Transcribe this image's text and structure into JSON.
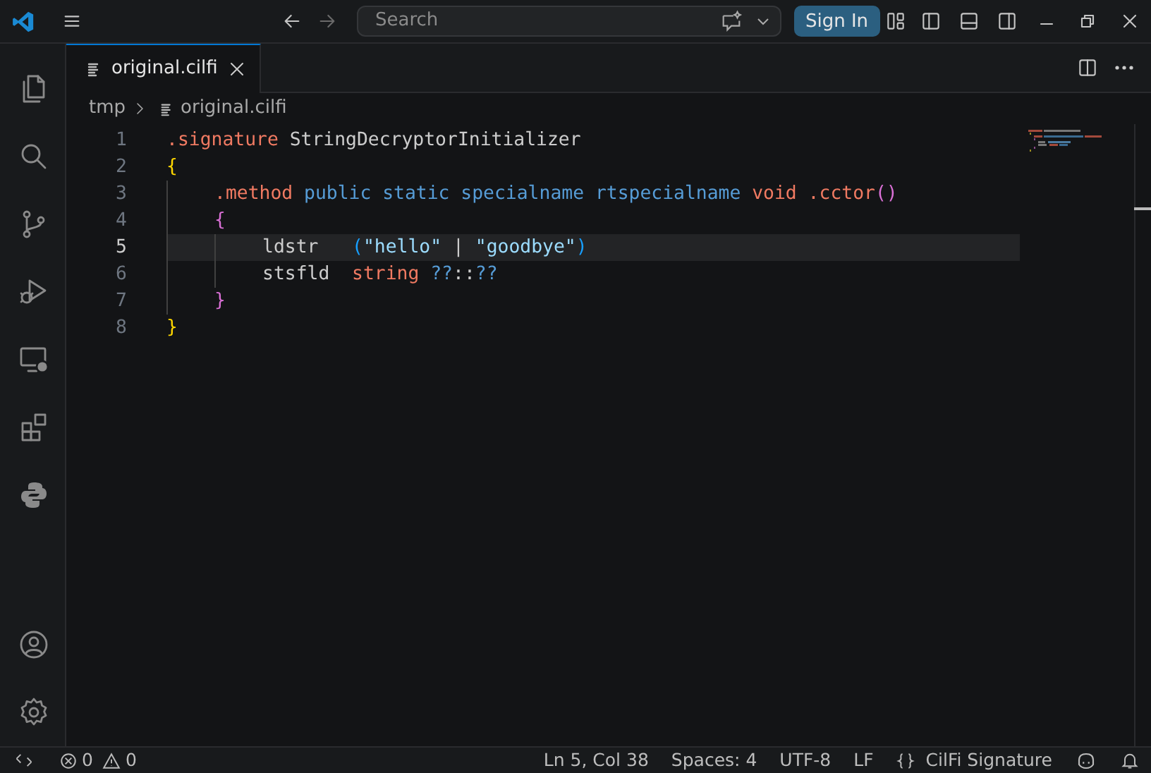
{
  "title_bar": {
    "search": {
      "placeholder": "Search"
    },
    "sign_in": "Sign In"
  },
  "activity_bar": {
    "items": [
      {
        "kind": "files",
        "selected": false
      },
      {
        "kind": "search",
        "selected": false
      },
      {
        "kind": "source-control",
        "selected": false
      },
      {
        "kind": "run-debug",
        "selected": false
      },
      {
        "kind": "remote",
        "selected": false
      },
      {
        "kind": "extensions",
        "selected": false
      },
      {
        "kind": "python",
        "selected": false
      }
    ],
    "bottom": [
      {
        "kind": "account"
      },
      {
        "kind": "settings"
      }
    ]
  },
  "tabs": [
    {
      "label": "original.cilfi",
      "selected": true
    }
  ],
  "breadcrumb": [
    "tmp",
    "original.cilfi"
  ],
  "editor": {
    "lines": [
      {
        "number": "1",
        "current": false,
        "tokens": [
          {
            "text": ".signature",
            "kind": "directive"
          },
          {
            "text": " StringDecryptorInitializer",
            "kind": "plain"
          }
        ]
      },
      {
        "number": "2",
        "current": false,
        "tokens": [
          {
            "text": "{",
            "kind": "brace1"
          }
        ]
      },
      {
        "kind": "block",
        "children": [
          {
            "number": "3",
            "current": false,
            "tokens": [
              {
                "text": ".method",
                "kind": "directive"
              },
              {
                "text": " public static specialname rtspecialname",
                "kind": "keyword"
              },
              {
                "text": " void .cctor",
                "kind": "directive"
              },
              {
                "text": "()",
                "kind": "brace2"
              }
            ]
          },
          {
            "number": "4",
            "current": false,
            "tokens": [
              {
                "text": "{",
                "kind": "brace2"
              }
            ]
          },
          {
            "kind": "block",
            "children": [
              {
                "number": "5",
                "current": true,
                "tokens": [
                  {
                    "text": "ldstr   ",
                    "kind": "plain"
                  },
                  {
                    "text": "(",
                    "kind": "brace3"
                  },
                  {
                    "text": "\"hello\"",
                    "kind": "string"
                  },
                  {
                    "text": " | ",
                    "kind": "plain"
                  },
                  {
                    "text": "\"goodbye\"",
                    "kind": "string"
                  },
                  {
                    "text": ")",
                    "kind": "brace3"
                  }
                ]
              },
              {
                "number": "6",
                "current": false,
                "tokens": [
                  {
                    "text": "stsfld  ",
                    "kind": "plain"
                  },
                  {
                    "text": "string",
                    "kind": "directive"
                  },
                  {
                    "text": " ??",
                    "kind": "keyword"
                  },
                  {
                    "text": "::",
                    "kind": "plain"
                  },
                  {
                    "text": "??",
                    "kind": "keyword"
                  }
                ]
              }
            ]
          },
          {
            "number": "7",
            "current": false,
            "tokens": [
              {
                "text": "}",
                "kind": "brace2"
              }
            ]
          }
        ]
      },
      {
        "number": "8",
        "current": false,
        "tokens": [
          {
            "text": "}",
            "kind": "brace1"
          }
        ]
      }
    ]
  },
  "status_bar": {
    "errors": "0",
    "warnings": "0",
    "items": [
      "Ln 5, Col 38",
      "Spaces: 4",
      "UTF-8",
      "LF"
    ],
    "language": "CilFi Signature"
  }
}
